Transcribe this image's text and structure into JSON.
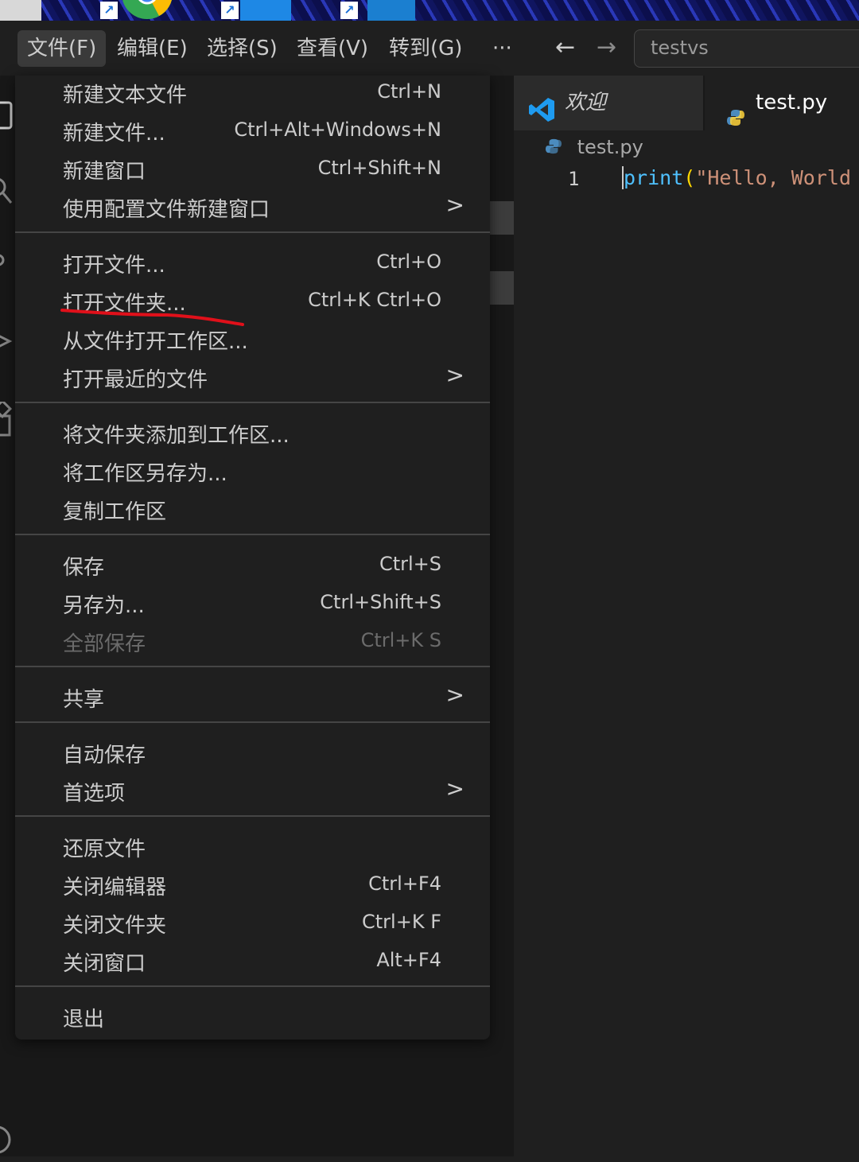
{
  "menubar": {
    "items": [
      "文件(F)",
      "编辑(E)",
      "选择(S)",
      "查看(V)",
      "转到(G)",
      "···"
    ],
    "search_text": "testvs"
  },
  "editor": {
    "tabs": [
      {
        "label": "欢迎",
        "icon": "vscode-logo-icon"
      },
      {
        "label": "test.py",
        "icon": "python-icon"
      }
    ],
    "breadcrumb": "test.py",
    "line_number": "1",
    "code": {
      "fn": "print",
      "paren": "(",
      "str": "\"Hello, World"
    }
  },
  "file_menu": {
    "items": [
      {
        "label": "新建文本文件",
        "shortcut": "Ctrl+N"
      },
      {
        "label": "新建文件...",
        "shortcut": "Ctrl+Alt+Windows+N"
      },
      {
        "label": "新建窗口",
        "shortcut": "Ctrl+Shift+N"
      },
      {
        "label": "使用配置文件新建窗口",
        "submenu": true
      },
      {
        "label": "打开文件...",
        "shortcut": "Ctrl+O"
      },
      {
        "label": "打开文件夹...",
        "shortcut": "Ctrl+K Ctrl+O"
      },
      {
        "label": "从文件打开工作区..."
      },
      {
        "label": "打开最近的文件",
        "submenu": true
      },
      {
        "label": "将文件夹添加到工作区..."
      },
      {
        "label": "将工作区另存为..."
      },
      {
        "label": "复制工作区"
      },
      {
        "label": "保存",
        "shortcut": "Ctrl+S"
      },
      {
        "label": "另存为...",
        "shortcut": "Ctrl+Shift+S"
      },
      {
        "label": "全部保存",
        "shortcut": "Ctrl+K S",
        "disabled": true
      },
      {
        "label": "共享",
        "submenu": true
      },
      {
        "label": "自动保存"
      },
      {
        "label": "首选项",
        "submenu": true
      },
      {
        "label": "还原文件"
      },
      {
        "label": "关闭编辑器",
        "shortcut": "Ctrl+F4"
      },
      {
        "label": "关闭文件夹",
        "shortcut": "Ctrl+K F"
      },
      {
        "label": "关闭窗口",
        "shortcut": "Alt+F4"
      },
      {
        "label": "退出"
      }
    ]
  },
  "colors": {
    "accent_blue": "#0078d4",
    "annotation_red": "#e0101a",
    "menu_bg": "#1f1f1f"
  }
}
